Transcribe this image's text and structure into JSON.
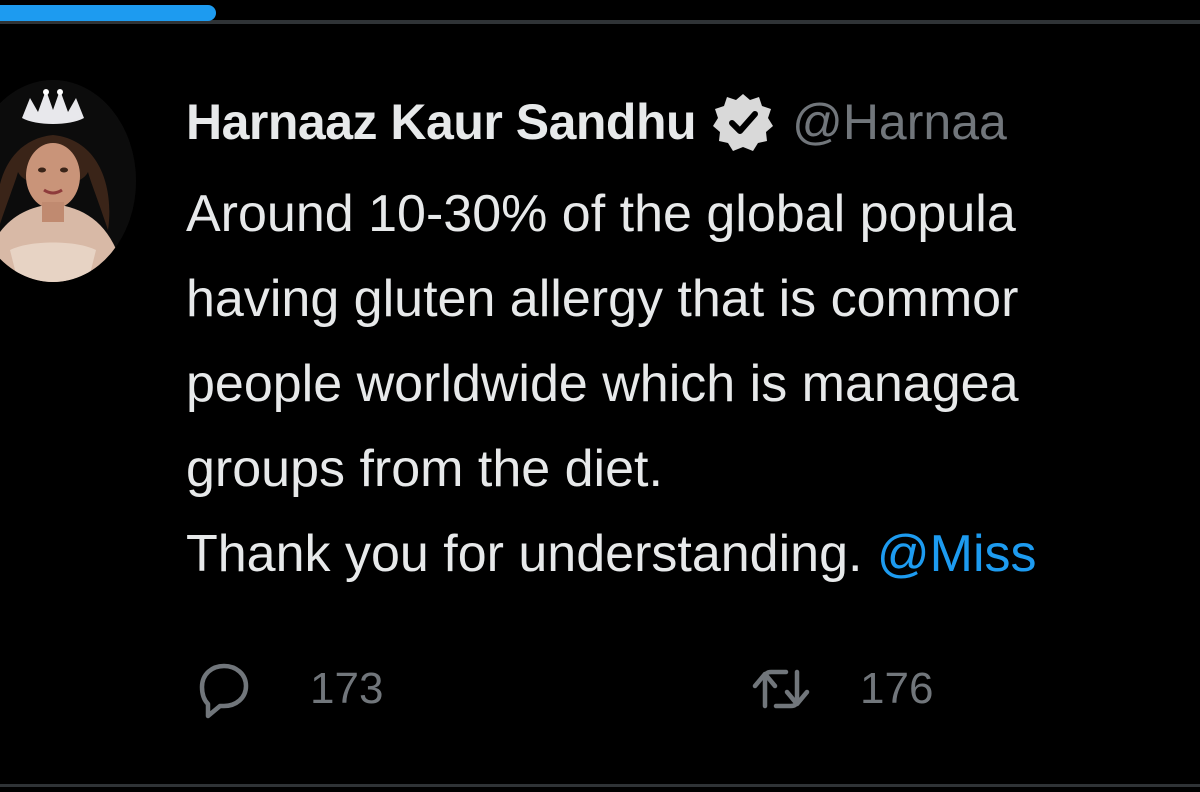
{
  "loading_progress": 0.18,
  "colors": {
    "background": "#000000",
    "text": "#e7e9ea",
    "secondary": "#71767b",
    "accent": "#1d9bf0",
    "divider": "#2f3336"
  },
  "tweet": {
    "avatar_icon": "profile-photo",
    "author": {
      "display_name": "Harnaaz Kaur Sandhu",
      "verified_icon": "verified-badge-icon",
      "handle": "@Harnaa"
    },
    "text_lines": [
      "Around 10-30% of the global popula",
      "having gluten allergy that is commor",
      "people worldwide which is managea",
      "groups from the diet."
    ],
    "last_line_text": "Thank you for understanding.",
    "mention": "@Miss",
    "actions": {
      "reply": {
        "icon": "reply-icon",
        "count": "173"
      },
      "retweet": {
        "icon": "retweet-icon",
        "count": "176"
      }
    }
  }
}
